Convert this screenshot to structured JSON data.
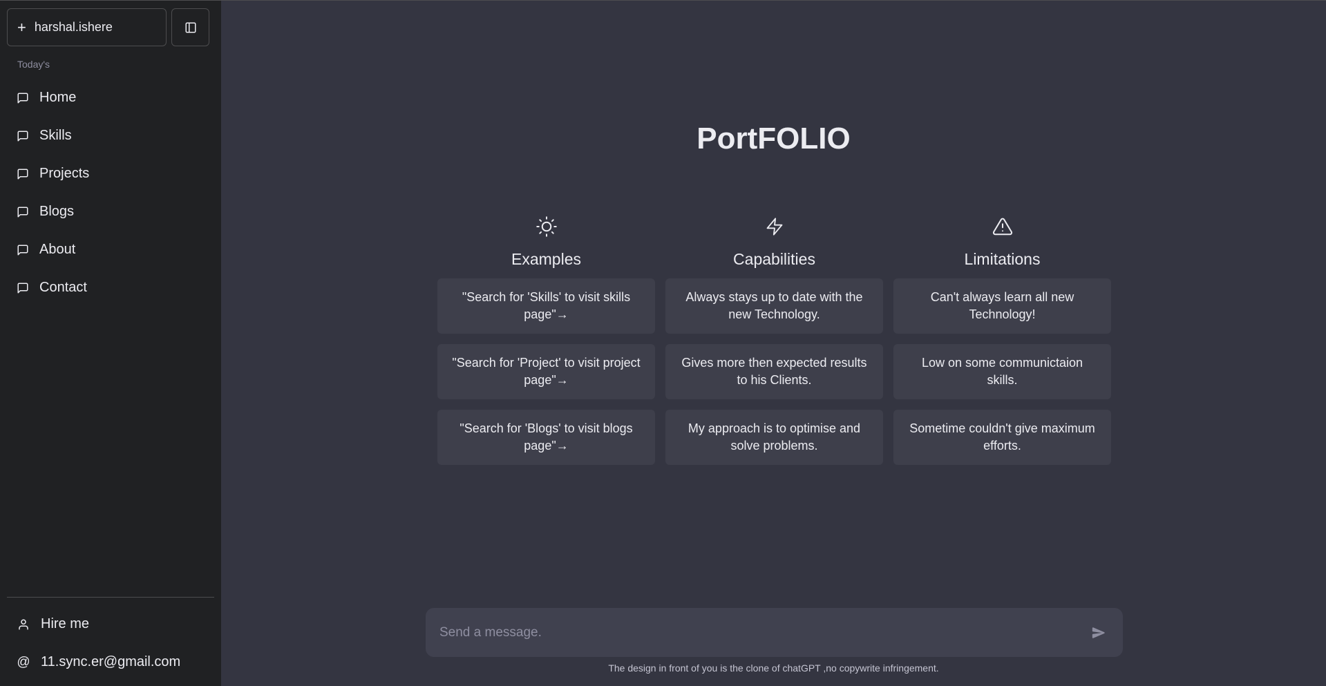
{
  "sidebar": {
    "new_chat_label": "harshal.ishere",
    "section_label": "Today's",
    "items": [
      {
        "label": "Home"
      },
      {
        "label": "Skills"
      },
      {
        "label": "Projects"
      },
      {
        "label": "Blogs"
      },
      {
        "label": "About"
      },
      {
        "label": "Contact"
      }
    ],
    "hire_label": "Hire me",
    "email_symbol": "@",
    "email_label": "11.sync.er@gmail.com"
  },
  "main": {
    "title": "PortFOLIO",
    "columns": [
      {
        "title": "Examples",
        "icon": "sun-icon",
        "cards": [
          "\"Search for 'Skills' to visit skills page\"→",
          "\"Search for 'Project' to visit project page\"→",
          "\"Search for 'Blogs' to visit blogs page\"→"
        ]
      },
      {
        "title": "Capabilities",
        "icon": "lightning-icon",
        "cards": [
          "Always stays up to date with the new Technology.",
          "Gives more then expected results to his Clients.",
          "My approach is to optimise and solve problems."
        ]
      },
      {
        "title": "Limitations",
        "icon": "warning-icon",
        "cards": [
          "Can't always learn all new Technology!",
          "Low on some communictaion skills.",
          "Sometime couldn't give maximum efforts."
        ]
      }
    ],
    "composer": {
      "placeholder": "Send a message."
    },
    "footer_note": "The design in front of you is the clone of chatGPT ,no copywrite infringement."
  },
  "colors": {
    "sidebar_bg": "#202123",
    "main_bg": "#343541",
    "card_bg": "#3e3f4b",
    "composer_bg": "#40414f"
  }
}
